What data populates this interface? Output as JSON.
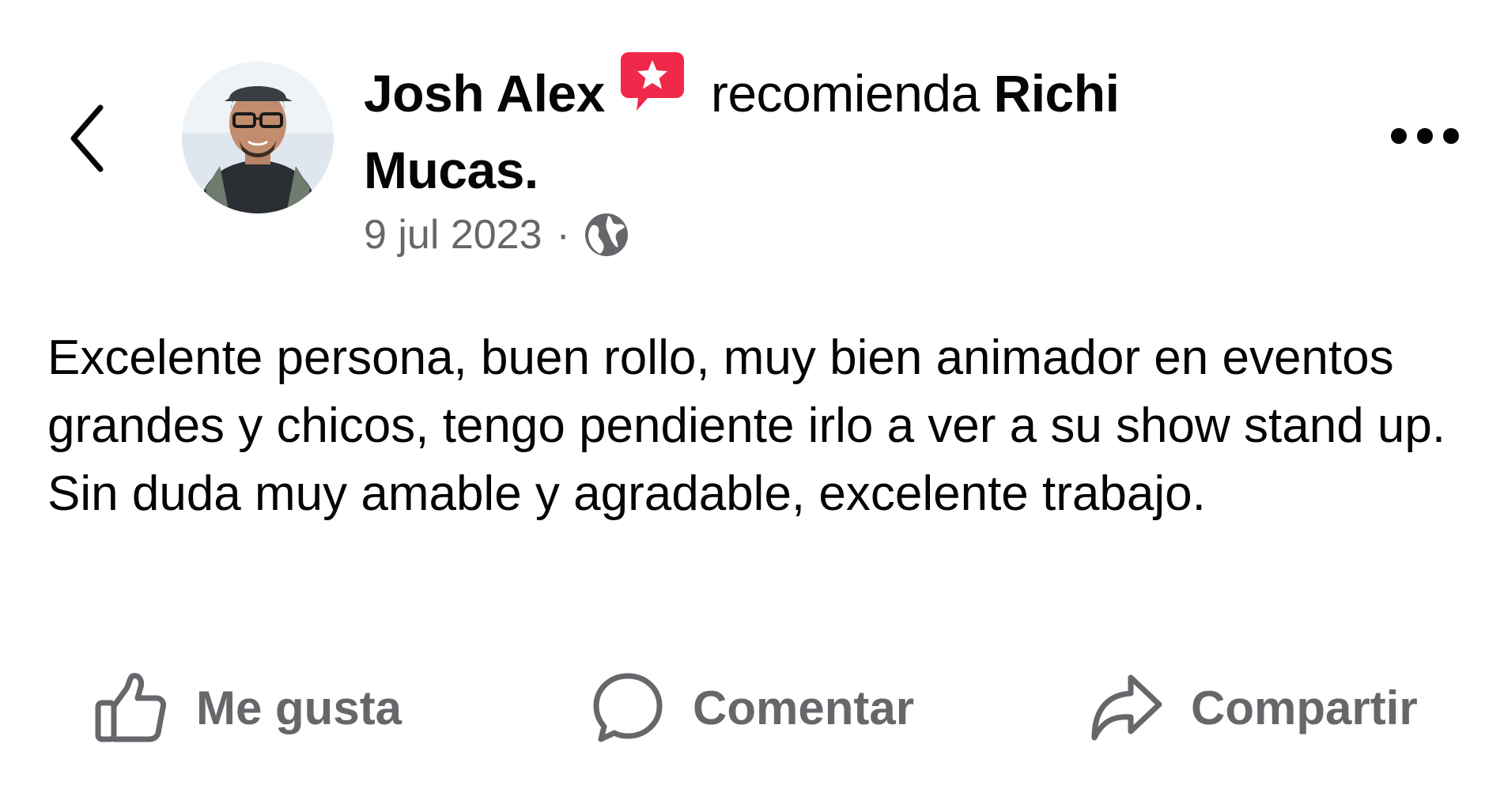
{
  "header": {
    "author_name": "Josh Alex",
    "verb": "recomienda",
    "page_name_line1": "Richi",
    "page_name_line2": "Mucas.",
    "date": "9 jul 2023",
    "separator": "·",
    "icons": {
      "back": "chevron-left-icon",
      "recommend": "recommend-star-icon",
      "audience": "globe-icon",
      "more": "more-options-icon"
    }
  },
  "post": {
    "text": "Excelente persona, buen rollo, muy bien animador en eventos grandes y chicos, tengo pendiente irlo a ver a su show stand up. Sin duda muy amable y agradable, excelente trabajo."
  },
  "actions": {
    "like_label": "Me gusta",
    "comment_label": "Comentar",
    "share_label": "Compartir"
  },
  "colors": {
    "text_primary": "#050505",
    "text_secondary": "#65676b",
    "recommend_badge": "#f02849",
    "background": "#ffffff"
  }
}
